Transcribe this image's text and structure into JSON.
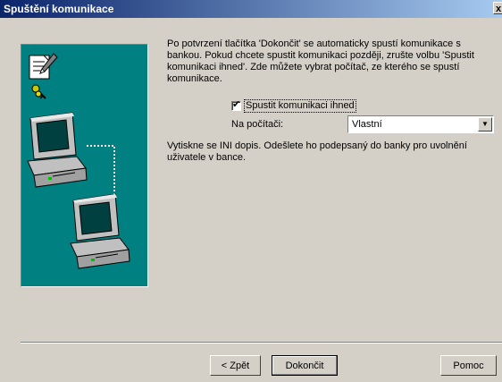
{
  "window": {
    "title": "Spuštění komunikace",
    "close_glyph": "x"
  },
  "illustration": {
    "icons": [
      "document-pen-icon",
      "key-icon",
      "computer-icon",
      "computer-icon"
    ],
    "background_color": "#008080"
  },
  "intro_text": "Po potvrzení tlačítka 'Dokončit' se automaticky spustí komunikace s bankou. Pokud chcete spustit komunikaci později, zrušte volbu 'Spustit komunikaci ihned'. Zde můžete vybrat počítač, ze kterého se spustí komunikace.",
  "start_now": {
    "label": "Spustit komunikaci ihned",
    "checked": true,
    "check_glyph": "✔"
  },
  "computer": {
    "label": "Na počítači:",
    "selected": "Vlastní"
  },
  "note_text": "Vytiskne se INI dopis. Odešlete ho podepsaný do banky pro uvolnění uživatele v bance.",
  "buttons": {
    "back": "< Zpět",
    "finish": "Dokončit",
    "help": "Pomoc"
  }
}
